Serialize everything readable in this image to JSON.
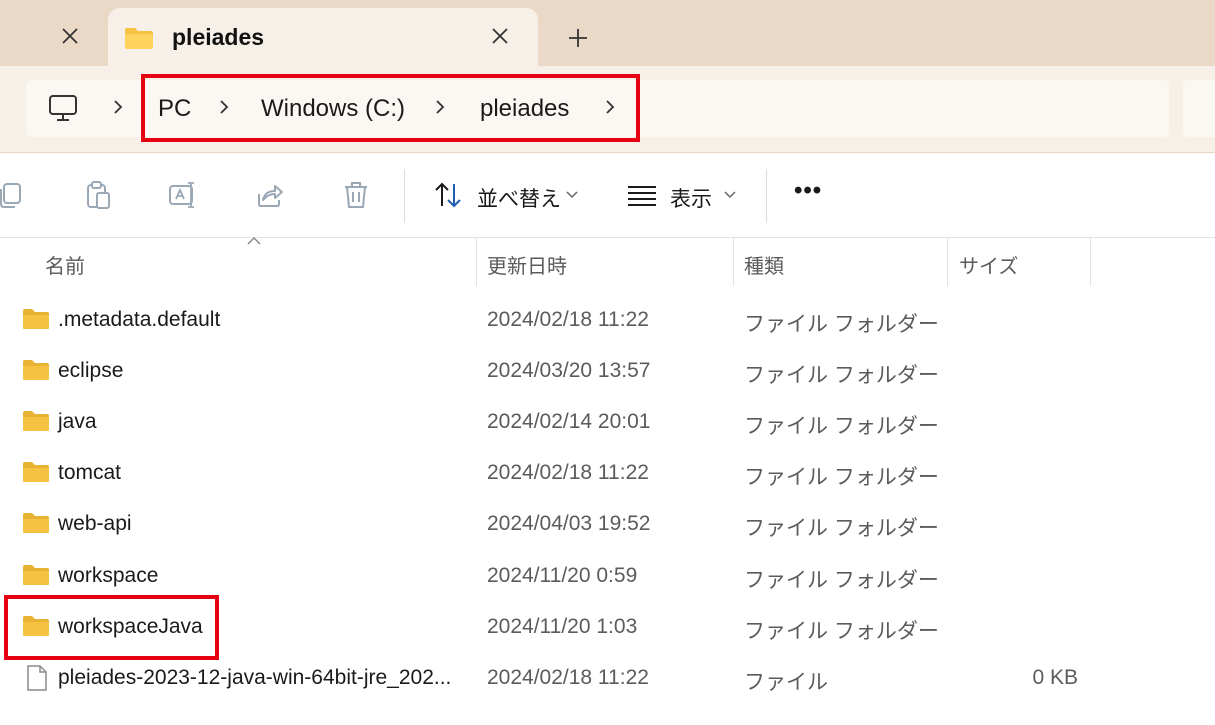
{
  "tabs": {
    "active_title": "pleiades"
  },
  "address": {
    "crumbs": [
      "PC",
      "Windows (C:)",
      "pleiades"
    ]
  },
  "toolbar": {
    "sort_label": "並べ替え",
    "view_label": "表示",
    "more_label": "•••"
  },
  "columns": {
    "name": "名前",
    "date": "更新日時",
    "type": "種類",
    "size": "サイズ"
  },
  "files": [
    {
      "name": ".metadata.default",
      "date": "2024/02/18 11:22",
      "type": "ファイル フォルダー",
      "size": "",
      "icon": "folder-icon"
    },
    {
      "name": "eclipse",
      "date": "2024/03/20 13:57",
      "type": "ファイル フォルダー",
      "size": "",
      "icon": "folder-icon"
    },
    {
      "name": "java",
      "date": "2024/02/14 20:01",
      "type": "ファイル フォルダー",
      "size": "",
      "icon": "folder-icon"
    },
    {
      "name": "tomcat",
      "date": "2024/02/18 11:22",
      "type": "ファイル フォルダー",
      "size": "",
      "icon": "folder-icon"
    },
    {
      "name": "web-api",
      "date": "2024/04/03 19:52",
      "type": "ファイル フォルダー",
      "size": "",
      "icon": "folder-icon"
    },
    {
      "name": "workspace",
      "date": "2024/11/20 0:59",
      "type": "ファイル フォルダー",
      "size": "",
      "icon": "folder-icon"
    },
    {
      "name": "workspaceJava",
      "date": "2024/11/20 1:03",
      "type": "ファイル フォルダー",
      "size": "",
      "icon": "folder-icon"
    },
    {
      "name": "pleiades-2023-12-java-win-64bit-jre_202...",
      "date": "2024/02/18 11:22",
      "type": "ファイル",
      "size": "0 KB",
      "icon": "file-icon"
    }
  ],
  "colors": {
    "highlight": "#e60012",
    "folder": "#f5c242",
    "tab_strip": "#ebd9c7"
  }
}
